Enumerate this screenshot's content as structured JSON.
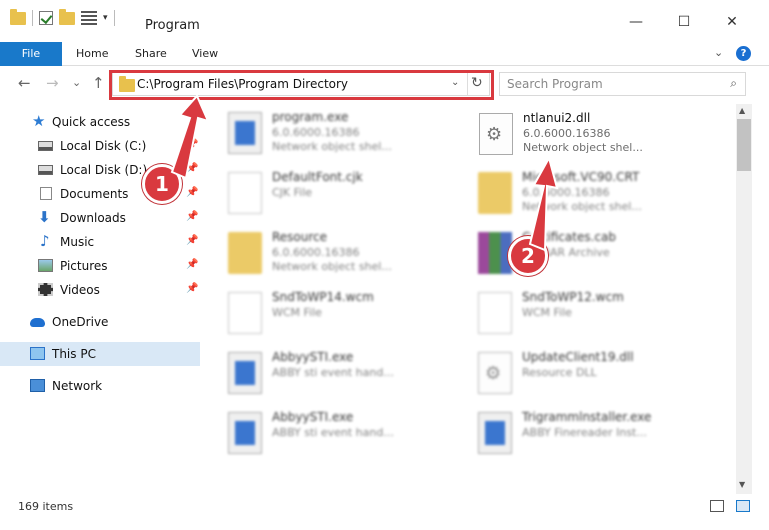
{
  "window": {
    "title": "Program",
    "minimize": "—",
    "maximize": "☐",
    "close": "✕"
  },
  "ribbon": {
    "file": "File",
    "home": "Home",
    "share": "Share",
    "view": "View",
    "help": "?"
  },
  "nav": {
    "back": "←",
    "forward": "→",
    "recent": "⌄",
    "up": "↑",
    "address": "C:\\Program Files\\Program Directory",
    "refresh": "↻",
    "search_placeholder": "Search Program"
  },
  "sidebar": {
    "items": [
      {
        "label": "Quick access",
        "icon": "star-icon"
      },
      {
        "label": "Local Disk (C:)",
        "icon": "disk-icon"
      },
      {
        "label": "Local Disk (D:)",
        "icon": "disk-icon"
      },
      {
        "label": "Documents",
        "icon": "documents-icon"
      },
      {
        "label": "Downloads",
        "icon": "download-icon"
      },
      {
        "label": "Music",
        "icon": "music-icon"
      },
      {
        "label": "Pictures",
        "icon": "pictures-icon"
      },
      {
        "label": "Videos",
        "icon": "videos-icon"
      },
      {
        "label": "OneDrive",
        "icon": "onedrive-icon"
      },
      {
        "label": "This PC",
        "icon": "this-pc-icon"
      },
      {
        "label": "Network",
        "icon": "network-icon"
      }
    ]
  },
  "files": [
    {
      "name": "program.exe",
      "line1": "6.0.6000.16386",
      "line2": "Network object shel...",
      "icon": "exe"
    },
    {
      "name": "ntlanui2.dll",
      "line1": "6.0.6000.16386",
      "line2": "Network object shel...",
      "icon": "dll"
    },
    {
      "name": "DefaultFont.cjk",
      "line1": "CJK File",
      "line2": "",
      "icon": "doc"
    },
    {
      "name": "Microsoft.VC90.CRT",
      "line1": "6.0.6000.16386",
      "line2": "Network object shel...",
      "icon": "folder"
    },
    {
      "name": "Resource",
      "line1": "6.0.6000.16386",
      "line2": "Network object shel...",
      "icon": "folder"
    },
    {
      "name": "Certificates.cab",
      "line1": "WinRAR Archive",
      "line2": "",
      "icon": "rar"
    },
    {
      "name": "SndToWP14.wcm",
      "line1": "WCM File",
      "line2": "",
      "icon": "doc"
    },
    {
      "name": "SndToWP12.wcm",
      "line1": "WCM File",
      "line2": "",
      "icon": "doc"
    },
    {
      "name": "AbbyySTI.exe",
      "line1": "ABBY sti event hand...",
      "line2": "",
      "icon": "exe"
    },
    {
      "name": "UpdateClient19.dll",
      "line1": "Resource DLL",
      "line2": "",
      "icon": "dll"
    },
    {
      "name": "AbbyySTI.exe",
      "line1": "ABBY sti event hand...",
      "line2": "",
      "icon": "exe"
    },
    {
      "name": "Trigrammlnstaller.exe",
      "line1": "ABBY Finereader Inst...",
      "line2": "",
      "icon": "exe"
    }
  ],
  "status": {
    "count": "169 items"
  },
  "callouts": {
    "one": "1",
    "two": "2"
  },
  "colors": {
    "accent": "#1979ca",
    "highlight": "#d9393f",
    "selected": "#d9e8f6"
  }
}
